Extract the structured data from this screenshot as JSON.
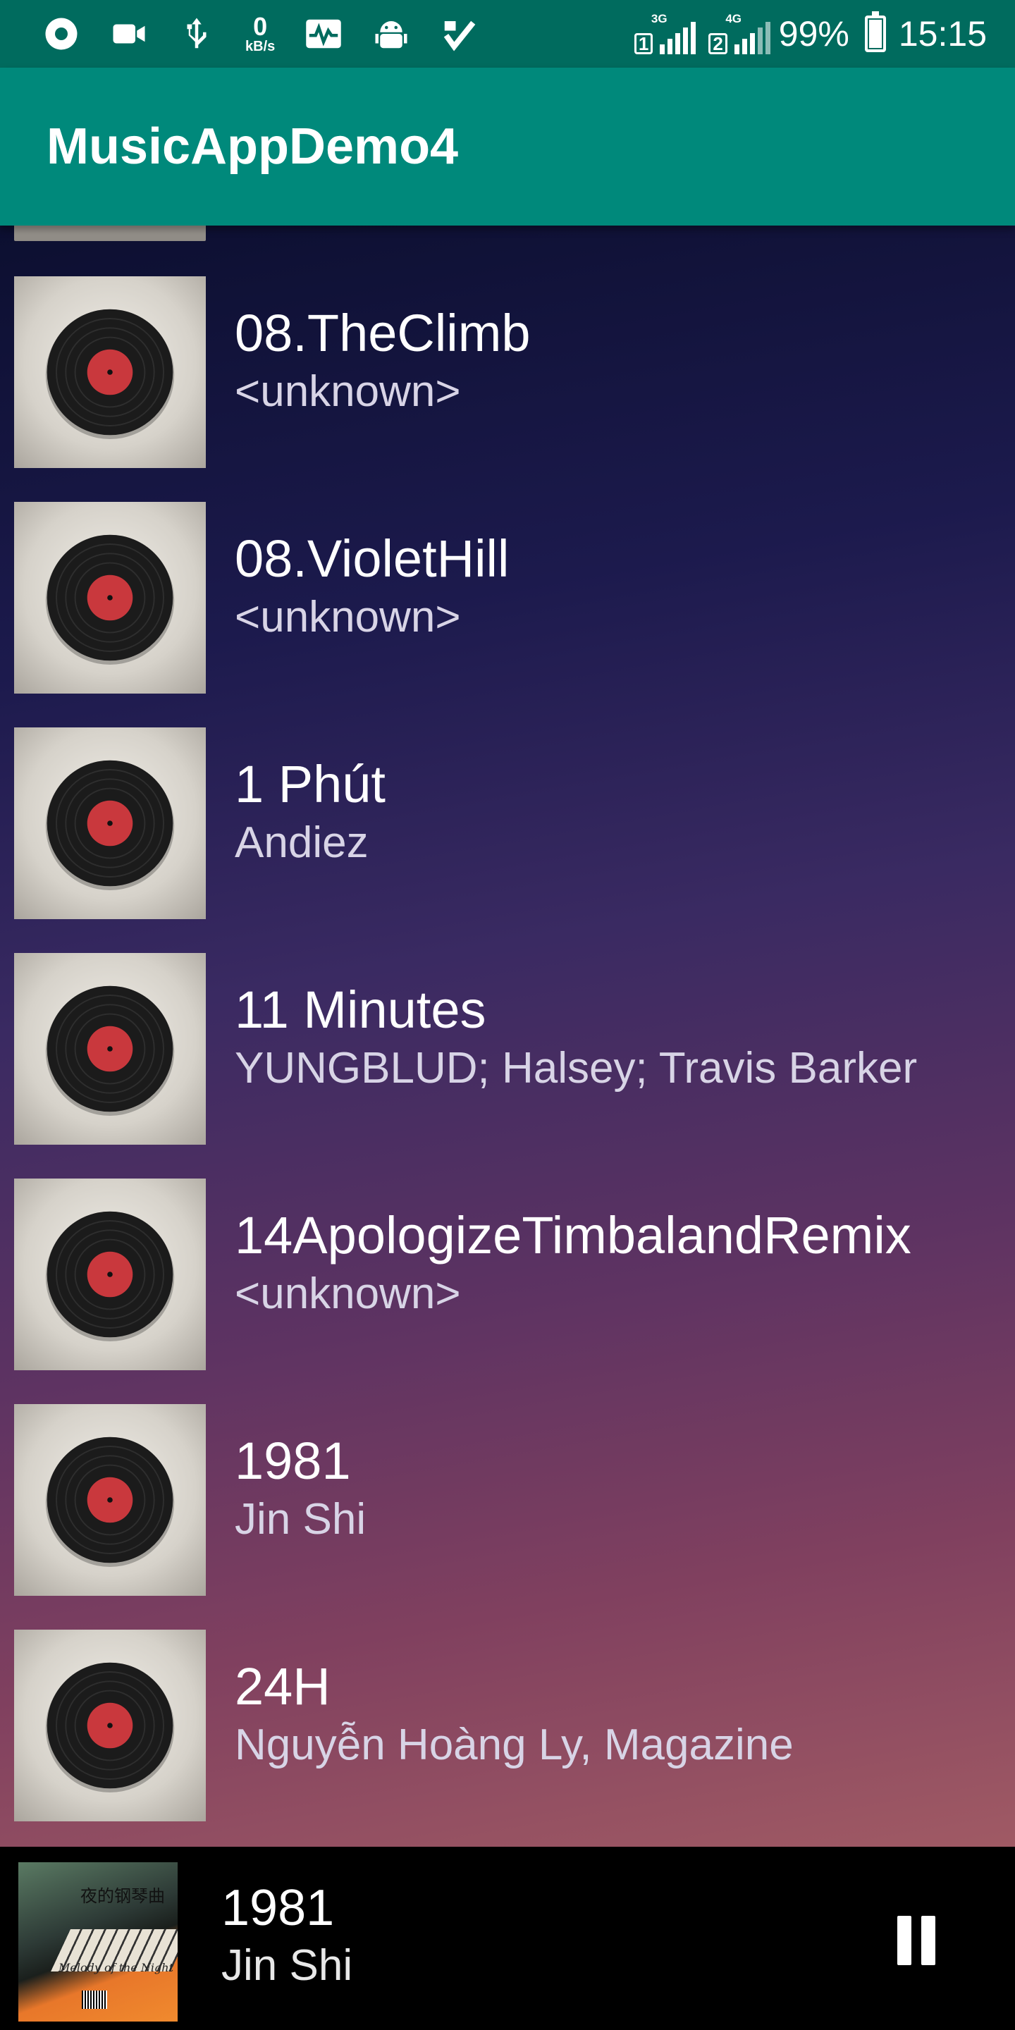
{
  "status_bar": {
    "icons_left": [
      "record-icon",
      "video-camera-icon",
      "usb-icon",
      "network-speed-icon",
      "activity-monitor-icon",
      "android-debug-icon",
      "task-check-icon"
    ],
    "net_speed_value": "0",
    "net_speed_unit": "kB/s",
    "sim1_tag": "3G",
    "sim1_label": "1",
    "sim2_tag": "4G",
    "sim2_label": "2",
    "battery": "99%",
    "time": "15:15"
  },
  "app_bar": {
    "title": "MusicAppDemo4"
  },
  "songs": [
    {
      "title": "08.TheClimb",
      "artist": "<unknown>"
    },
    {
      "title": "08.VioletHill",
      "artist": "<unknown>"
    },
    {
      "title": "1 Phút",
      "artist": "Andiez"
    },
    {
      "title": "11 Minutes",
      "artist": "YUNGBLUD; Halsey; Travis Barker"
    },
    {
      "title": "14ApologizeTimbalandRemix",
      "artist": "<unknown>"
    },
    {
      "title": "1981",
      "artist": "Jin Shi"
    },
    {
      "title": "24H",
      "artist": "Nguyễn Hoàng Ly, Magazine"
    }
  ],
  "now_playing": {
    "title": "1981",
    "artist": "Jin Shi",
    "cover_text_cn": "夜的钢琴曲",
    "cover_text_en": "Melody of the Night",
    "control_icon": "pause-icon"
  },
  "colors": {
    "status_bar": "#006b5e",
    "app_bar": "#00897b",
    "player_bar": "#000000"
  }
}
